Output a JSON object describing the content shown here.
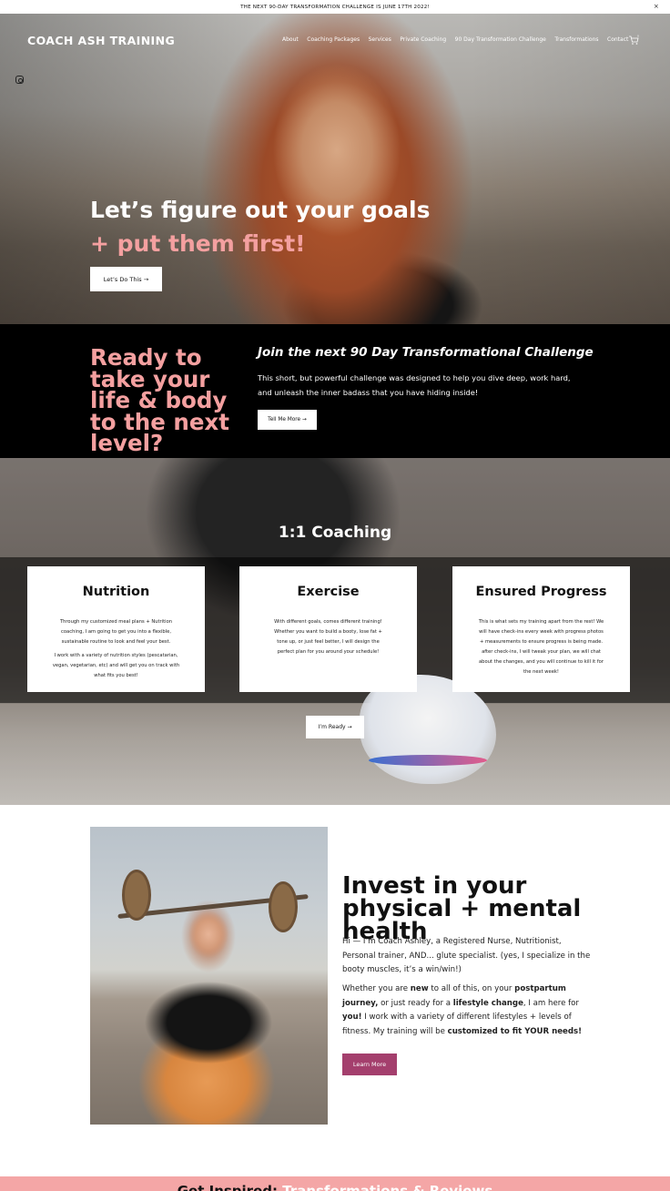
{
  "announcement": {
    "text": "THE NEXT 90-DAY TRANSFORMATION CHALLENGE IS JUNE 17TH 2022!",
    "close": "×"
  },
  "header": {
    "brand": "COACH ASH TRAINING",
    "nav": [
      "About",
      "Coaching Packages",
      "Services",
      "Private Coaching",
      "90 Day Transformation Challenge",
      "Transformations",
      "Contact"
    ],
    "cart_count": "0"
  },
  "hero": {
    "headline": "Let’s figure out your goals",
    "headline2": "+ put them first!",
    "cta": "Let’s Do This →"
  },
  "challenge": {
    "left_heading": "Ready to take your life & body to the next level?",
    "title": "Join the next 90 Day Transformational Challenge",
    "body": "This short, but powerful challenge was designed to help you dive deep, work hard, and unleash the inner badass that you have hiding inside!",
    "cta": "Tell Me More →"
  },
  "coaching": {
    "title": "1:1 Coaching",
    "cards": [
      {
        "title": "Nutrition",
        "p1": "Through my customized meal plans + Nutrition coaching, I am going to get you into a flexible, sustainable routine to look and feel your best.",
        "p2": "I work with a variety of nutrition styles (pescatarian, vegan, vegetarian, etc) and will get you on track with what fits you best!"
      },
      {
        "title": "Exercise",
        "p1": "With different goals, comes different training! Whether you want to build a booty, lose fat + tone up, or just feel better, I will design the perfect plan for you around your schedule!"
      },
      {
        "title": "Ensured Progress",
        "p1": "This is what sets my training apart from the rest! We will have check-ins every week with progress photos + measurements to ensure progress is being made. after check-ins, I will tweak your plan, we will chat about the changes, and you will continue to kill it for the next week!"
      }
    ],
    "cta": "I’m Ready →"
  },
  "about": {
    "heading": "Invest in your physical + mental health",
    "p1": "Hi — I’m Coach Ashley, a Registered Nurse, Nutritionist, Personal trainer, AND... glute specialist. (yes, I specialize in the booty muscles, it’s a win/win!)",
    "p2_a": "Whether you are ",
    "p2_new": "new",
    "p2_b": " to all of this, on your ",
    "p2_pp": "postpartum journey,",
    "p2_c": " or just ready for a ",
    "p2_lc": "lifestyle change",
    "p2_d": ", I am here for ",
    "p2_you": "you!",
    "p2_e": " I work with a variety of different lifestyles + levels of fitness. My training will be ",
    "p2_fit": "customized to fit YOUR needs!",
    "cta": "Learn More"
  },
  "inspired": {
    "dark": "Get Inspired: ",
    "light": "Transformations & Reviews"
  },
  "colors": {
    "pink": "#f4a0a0",
    "berry": "#a43f6d",
    "black": "#000000"
  }
}
